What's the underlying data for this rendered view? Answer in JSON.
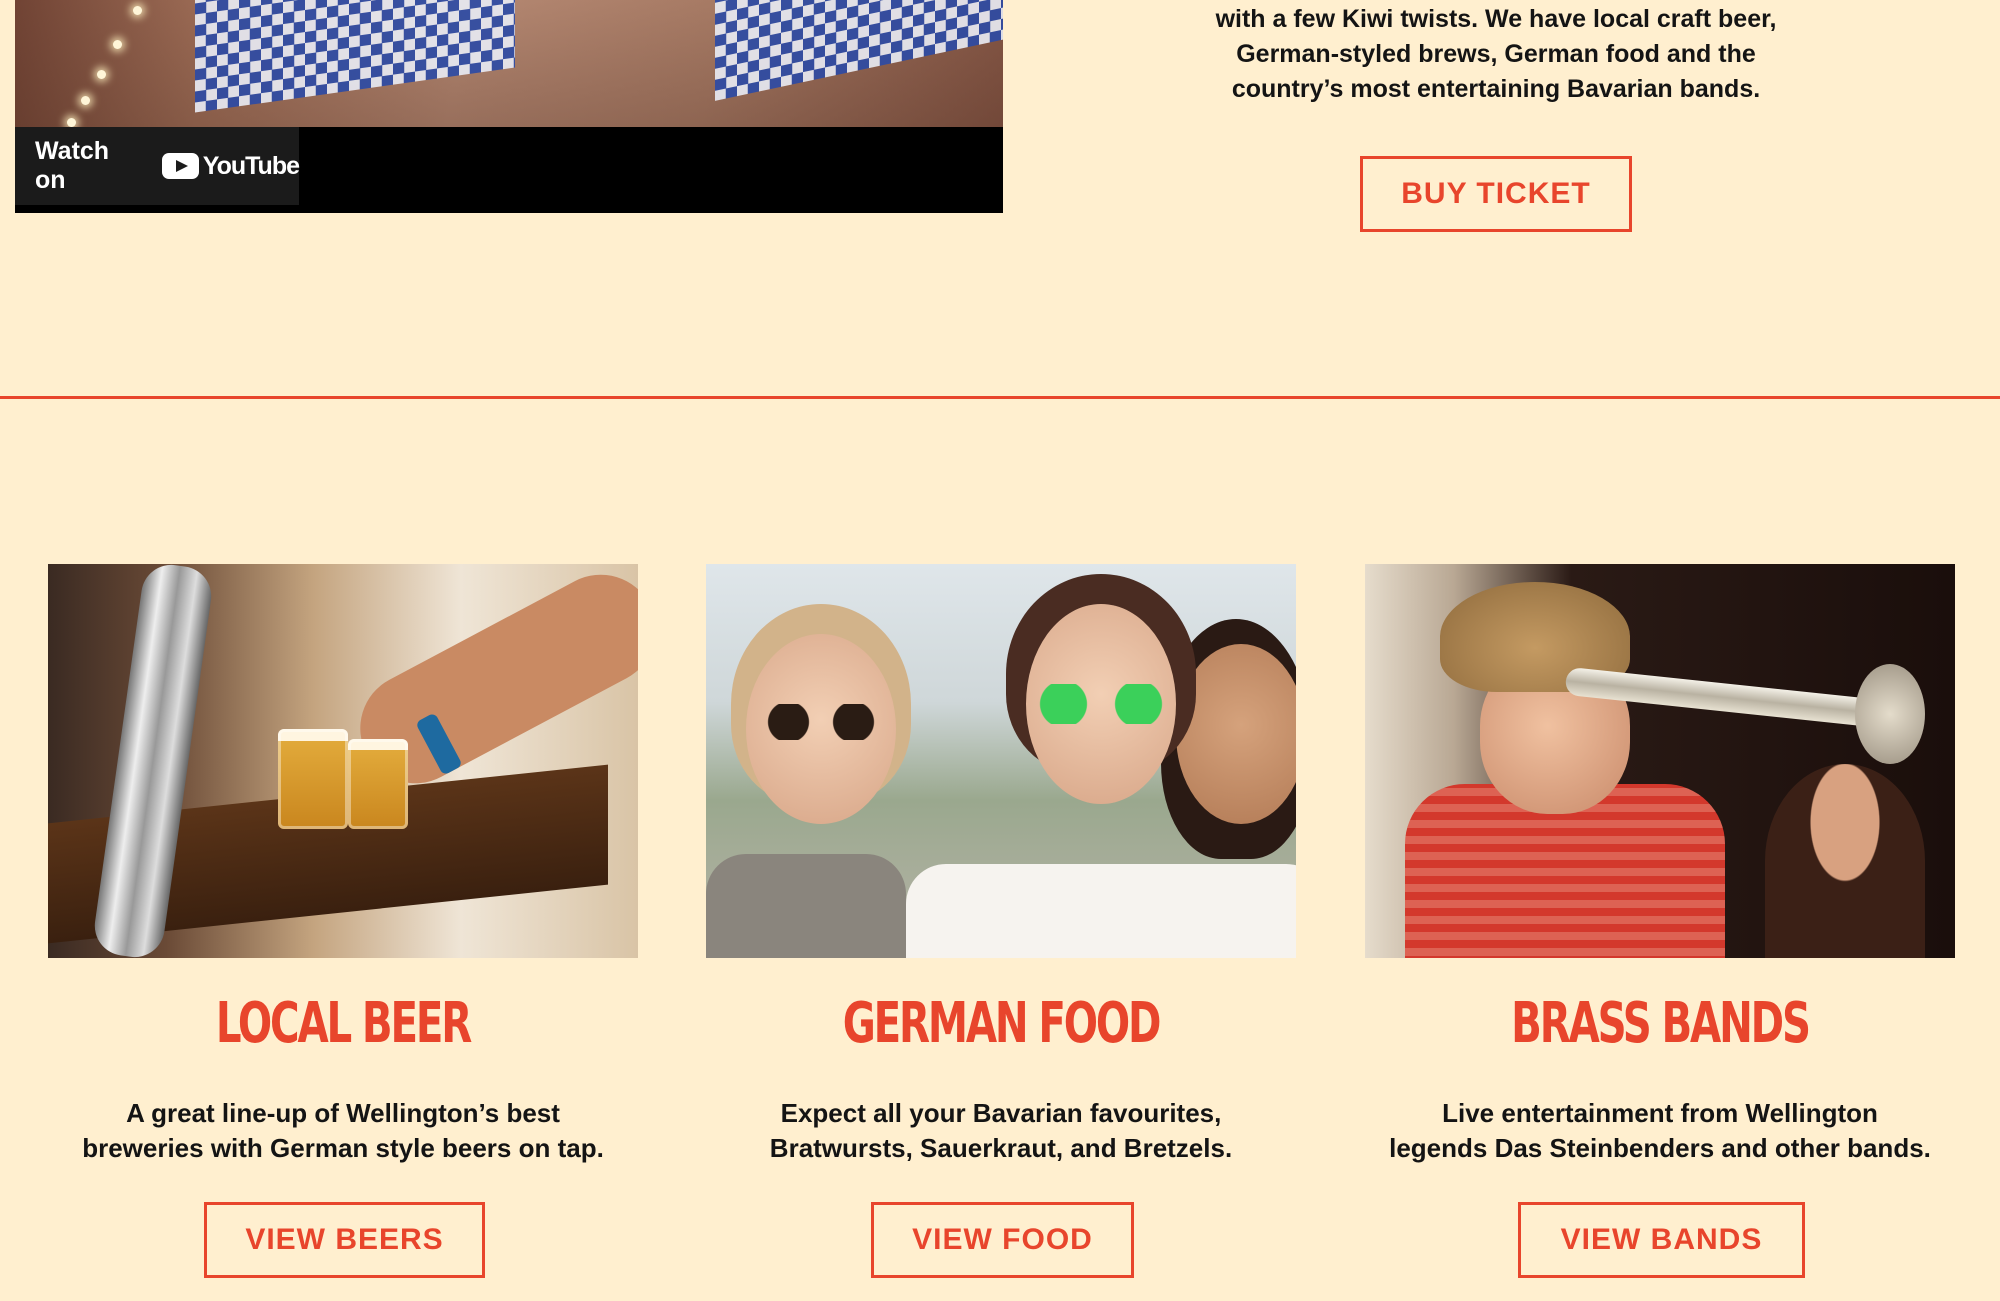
{
  "video": {
    "watch_label": "Watch on",
    "platform": "YouTube"
  },
  "intro": {
    "line1": "with a few Kiwi twists. We have local craft beer,",
    "line2": "German-styled brews, German food and the",
    "line3": "country’s most entertaining Bavarian bands.",
    "ticket_button": "BUY TICKET"
  },
  "features": [
    {
      "title": "LOCAL BEER",
      "text_line1": "A great line-up of Wellington’s best",
      "text_line2": "breweries with German style beers on tap.",
      "button": "VIEW BEERS"
    },
    {
      "title": "GERMAN FOOD",
      "text_line1": "Expect all your Bavarian favourites,",
      "text_line2": "Bratwursts, Sauerkraut, and Bretzels.",
      "button": "VIEW FOOD"
    },
    {
      "title": "BRASS BANDS",
      "text_line1": "Live entertainment from Wellington",
      "text_line2": "legends Das Steinbenders and other bands.",
      "button": "VIEW BANDS"
    }
  ],
  "colors": {
    "background": "#ffefcf",
    "accent": "#e8452c",
    "text": "#141414"
  }
}
